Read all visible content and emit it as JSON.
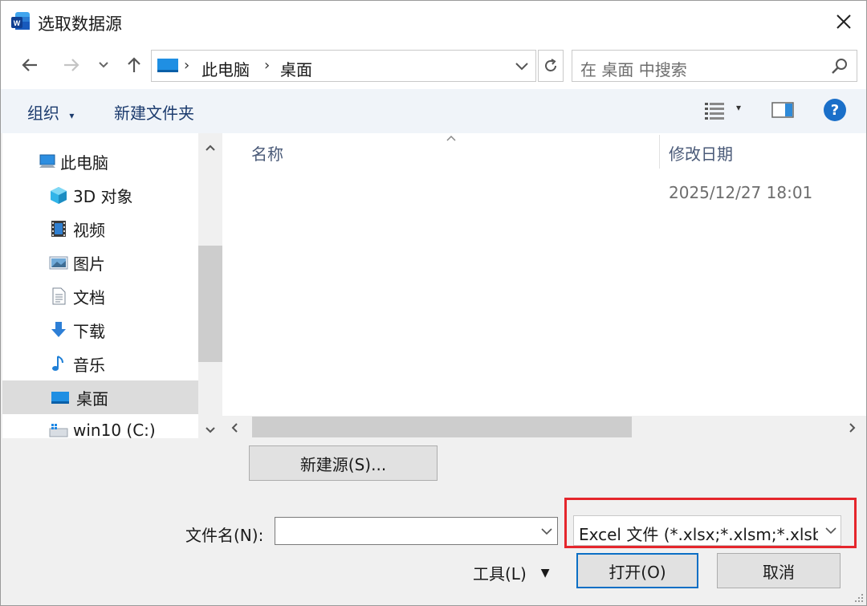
{
  "window": {
    "title": "选取数据源"
  },
  "nav": {
    "back_icon": "arrow-left-icon",
    "forward_icon": "arrow-right-icon",
    "recent_icon": "chevron-down-icon",
    "up_icon": "arrow-up-icon",
    "breadcrumbs": [
      "此电脑",
      "桌面"
    ],
    "refresh_icon": "refresh-icon",
    "search_placeholder": "在 桌面 中搜索"
  },
  "toolbar": {
    "organize_label": "组织",
    "new_folder_label": "新建文件夹",
    "view_icon": "details-view-icon",
    "preview_icon": "preview-pane-icon",
    "help_label": "?"
  },
  "sidebar": {
    "items": [
      {
        "label": "此电脑",
        "icon": "computer-icon"
      },
      {
        "label": "3D 对象",
        "icon": "3d-objects-icon"
      },
      {
        "label": "视频",
        "icon": "video-icon"
      },
      {
        "label": "图片",
        "icon": "pictures-icon"
      },
      {
        "label": "文档",
        "icon": "documents-icon"
      },
      {
        "label": "下载",
        "icon": "download-icon"
      },
      {
        "label": "音乐",
        "icon": "music-icon"
      },
      {
        "label": "桌面",
        "icon": "desktop-icon"
      },
      {
        "label": "win10 (C:)",
        "icon": "drive-icon"
      }
    ]
  },
  "files": {
    "columns": [
      "名称",
      "修改日期"
    ],
    "rows": [
      {
        "name": "",
        "modified": "2025/12/27 18:01"
      }
    ]
  },
  "footer": {
    "new_source_label": "新建源(S)...",
    "filename_label": "文件名(N):",
    "filename_value": "",
    "filter_value": "Excel 文件 (*.xlsx;*.xlsm;*.xlsb;*",
    "tools_label": "工具(L)",
    "open_label": "打开(O)",
    "cancel_label": "取消"
  },
  "colors": {
    "accent": "#0b6fc5",
    "highlight": "#e5262c",
    "help": "#1a6fc9"
  }
}
